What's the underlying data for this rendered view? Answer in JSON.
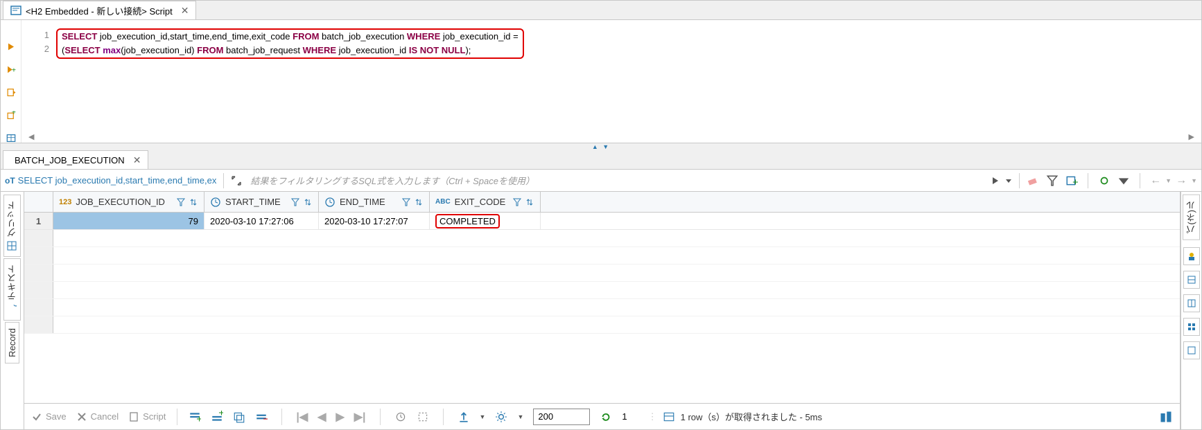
{
  "top_tab": {
    "title": "<H2 Embedded - 新しい接続> Script"
  },
  "editor": {
    "lines": [
      "1",
      "2"
    ],
    "sql_line1": {
      "select": "SELECT",
      "cols": " job_execution_id,start_time,end_time,exit_code ",
      "from": "FROM",
      "tbl": " batch_job_execution ",
      "where": "WHERE",
      "cond": " job_execution_id ="
    },
    "sql_line2": {
      "open": "(",
      "select": "SELECT ",
      "max": "max",
      "args": "(job_execution_id) ",
      "from": "FROM",
      "tbl": " batch_job_request ",
      "where": "WHERE",
      "cond": " job_execution_id ",
      "isnot": "IS NOT NULL",
      "close": ");"
    }
  },
  "result_tab": {
    "title": "BATCH_JOB_EXECUTION"
  },
  "result_toolbar": {
    "prefix": "oT",
    "sql_preview": "SELECT job_execution_id,start_time,end_time,ex",
    "filter_placeholder": "結果をフィルタリングするSQL式を入力します（Ctrl + Spaceを使用）"
  },
  "vtabs": {
    "grid": "グリッド",
    "text": "テキスト",
    "record": "Record",
    "panels": "パ(ネ)ル"
  },
  "columns": {
    "c1": "JOB_EXECUTION_ID",
    "c2": "START_TIME",
    "c3": "END_TIME",
    "c4": "EXIT_CODE",
    "c1type": "123",
    "c4type": "ABC"
  },
  "rows": [
    {
      "n": "1",
      "c1": "79",
      "c2": "2020-03-10 17:27:06",
      "c3": "2020-03-10 17:27:07",
      "c4": "COMPLETED"
    }
  ],
  "bottom": {
    "save": "Save",
    "cancel": "Cancel",
    "script": "Script",
    "page_value": "200",
    "refresh_count": "1",
    "status": "1 row（s）が取得されました - 5ms"
  }
}
